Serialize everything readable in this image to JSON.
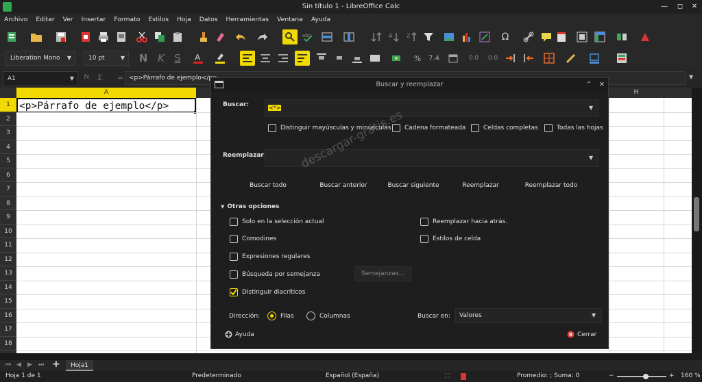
{
  "window": {
    "title": "Sin título 1 - LibreOffice Calc"
  },
  "menu": [
    "Archivo",
    "Editar",
    "Ver",
    "Insertar",
    "Formato",
    "Estilos",
    "Hoja",
    "Datos",
    "Herramientas",
    "Ventana",
    "Ayuda"
  ],
  "format_bar": {
    "font_name": "Liberation Mono",
    "font_size": "10 pt",
    "bold": "N",
    "italic": "K",
    "underline": "S",
    "percent": "%",
    "decimal": "7.4",
    "decimal_places": "0.0"
  },
  "formula_bar": {
    "cell_ref": "A1",
    "fx": "fx",
    "sigma": "Σ",
    "equals": "=",
    "content": "<p>Párrafo de ejemplo</p>"
  },
  "sheet": {
    "col_a": "A",
    "col_h": "H",
    "rows": [
      "1",
      "2",
      "3",
      "4",
      "5",
      "6",
      "7",
      "8",
      "9",
      "10",
      "11",
      "12",
      "13",
      "14",
      "15",
      "16",
      "17",
      "18"
    ],
    "cell_a1": "<p>Párrafo de ejemplo</p>"
  },
  "dialog": {
    "title": "Buscar y reemplazar",
    "search_label": "Buscar:",
    "search_value": "<*>",
    "match_case": "Distinguir mayúsculas y minúsculas",
    "formatted": "Cadena formateada",
    "entire_cells": "Celdas completas",
    "all_sheets": "Todas las hojas",
    "replace_label": "Reemplazar:",
    "replace_value": "",
    "btn_find_all": "Buscar todo",
    "btn_find_prev": "Buscar anterior",
    "btn_find_next": "Buscar siguiente",
    "btn_replace": "Reemplazar",
    "btn_replace_all": "Reemplazar todo",
    "other_options": "Otras opciones",
    "current_selection": "Solo en la selección actual",
    "replace_backwards": "Reemplazar hacia atrás.",
    "wildcards": "Comodines",
    "cell_styles": "Estilos de celda",
    "regex": "Expresiones regulares",
    "similarity": "Búsqueda por semejanza",
    "similarities_btn": "Semejanzas...",
    "diacritics": "Distinguir diacríticos",
    "direction_label": "Dirección:",
    "rows": "Filas",
    "columns": "Columnas",
    "search_in_label": "Buscar en:",
    "search_in_value": "Valores",
    "help": "Ayuda",
    "close": "Cerrar"
  },
  "watermark": "descargar-gratis.es",
  "sheet_tab": "Hoja1",
  "status": {
    "sheet": "Hoja 1 de 1",
    "style": "Predeterminado",
    "language": "Español (España)",
    "summary": "Promedio: ; Suma: 0",
    "zoom": "160 %"
  },
  "colors": {
    "accent": "#f2d900",
    "bg": "#1e1e1e"
  }
}
